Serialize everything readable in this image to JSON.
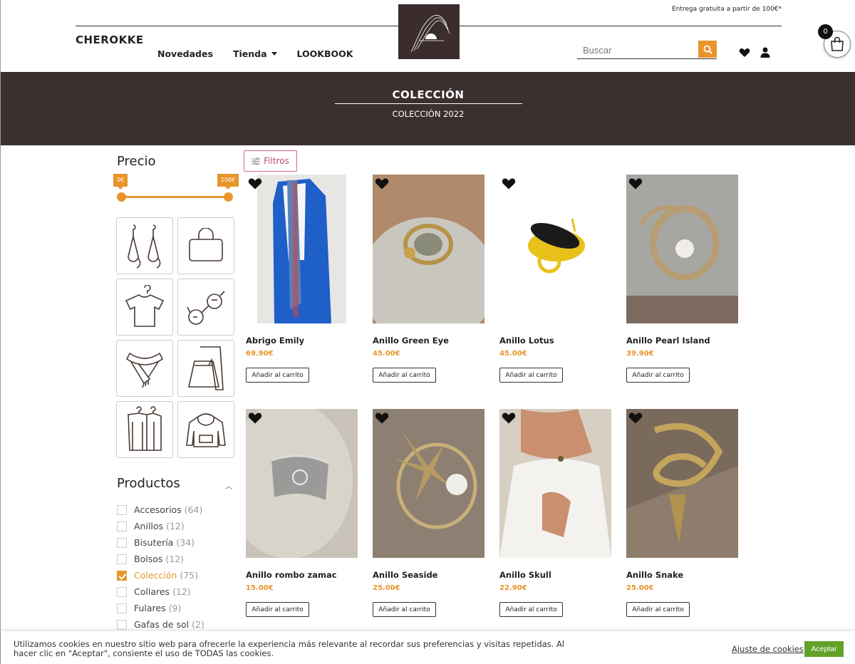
{
  "header": {
    "free_shipping": "Entrega gratuita a partir de 100€*",
    "brand": "CHEROKKE",
    "nav": [
      {
        "label": "Novedades"
      },
      {
        "label": "Tienda"
      },
      {
        "label": "LOOKBOOK"
      }
    ],
    "search_placeholder": "Buscar",
    "cart_count": "0"
  },
  "banner": {
    "title": "COLECCIÓN",
    "subtitle": "COLECCIÓN 2022"
  },
  "sidebar": {
    "price_title": "Precio",
    "price_min_label": "0€",
    "price_max_label": "100€",
    "categories": [
      "earrings-icon",
      "bag-icon",
      "tshirt-icon",
      "sunglasses-icon",
      "scarf-icon",
      "pants-skirt-icon",
      "clothes-rack-icon",
      "hoodie-icon"
    ],
    "products_title": "Productos",
    "filters": [
      {
        "name": "Accesorios",
        "count": "(64)",
        "checked": false
      },
      {
        "name": "Anillos",
        "count": "(12)",
        "checked": false
      },
      {
        "name": "Bisutería",
        "count": "(34)",
        "checked": false
      },
      {
        "name": "Bolsos",
        "count": "(12)",
        "checked": false
      },
      {
        "name": "Colección",
        "count": "(75)",
        "checked": true
      },
      {
        "name": "Collares",
        "count": "(12)",
        "checked": false
      },
      {
        "name": "Fulares",
        "count": "(9)",
        "checked": false
      },
      {
        "name": "Gafas de sol",
        "count": "(2)",
        "checked": false
      }
    ]
  },
  "filtros_label": "Filtros",
  "add_to_cart_label": "Añadir al carrito",
  "products": [
    {
      "name": "Abrigo Emily",
      "price": "69.90€"
    },
    {
      "name": "Anillo Green Eye",
      "price": "45.00€"
    },
    {
      "name": "Anillo Lotus",
      "price": "45.00€"
    },
    {
      "name": "Anillo Pearl Island",
      "price": "39.90€"
    },
    {
      "name": "Anillo rombo zamac",
      "price": "15.00€"
    },
    {
      "name": "Anillo Seaside",
      "price": "25.00€"
    },
    {
      "name": "Anillo Skull",
      "price": "22.90€"
    },
    {
      "name": "Anillo Snake",
      "price": "25.00€"
    }
  ],
  "cookie": {
    "text": "Utilizamos cookies en nuestro sitio web para ofrecerle la experiencia más relevante al recordar sus preferencias y visitas repetidas. Al hacer clic en \"Aceptar\", consiente el uso de TODAS las cookies.",
    "settings_label": "Ajuste de cookies",
    "accept_label": "Aceptar"
  },
  "colors": {
    "accent": "#e8952c",
    "banner_bg": "#3b2f2f",
    "accept_green": "#61a229",
    "filtros_pink": "#c24b75"
  }
}
